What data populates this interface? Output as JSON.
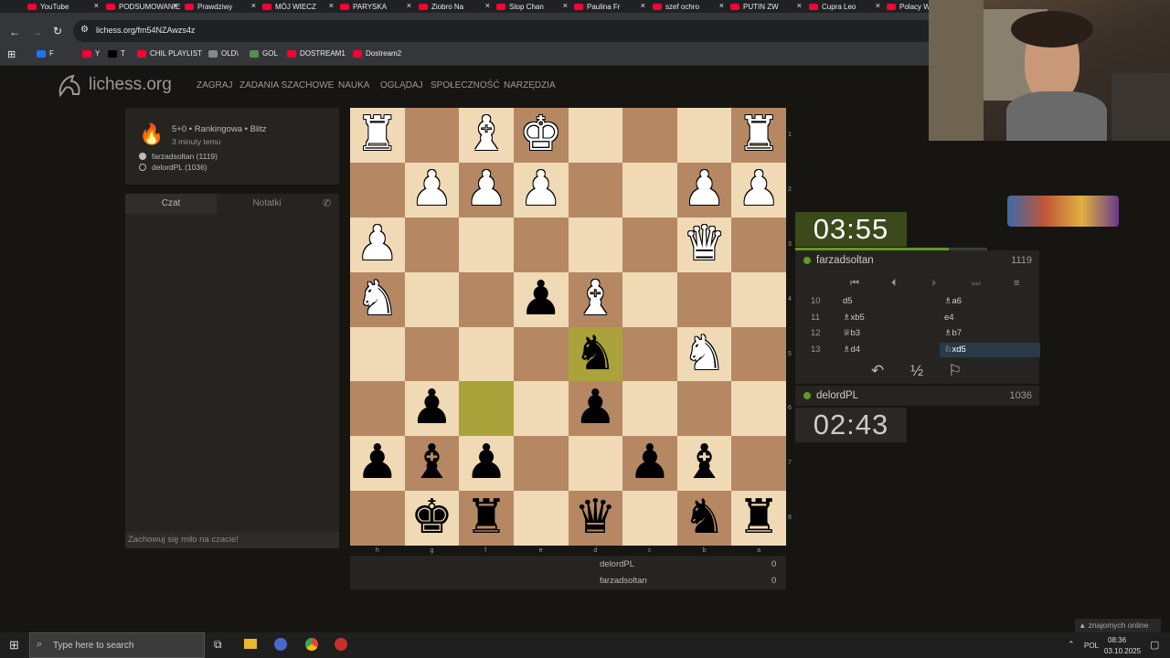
{
  "browser": {
    "tabs": [
      "YouTube",
      "PODSUMOWANIE",
      "Prawdziwy",
      "MÓJ WIECZ",
      "PARYSKA",
      "Ziobro Na",
      "Stop Chan",
      "Paulina Fr",
      "szef ochro",
      "PUTIN ZW",
      "Cupra Leo",
      "Polacy W"
    ],
    "url": "lichess.org/fm54NZAwzs4z",
    "bookmarks": [
      "F",
      "Y",
      "T",
      "CHIL PLAYLIST",
      "OLD\\",
      "GOL",
      "DOSTREAM1",
      "Dostream2"
    ]
  },
  "site": {
    "logo": "lichess.org",
    "nav": [
      "ZAGRAJ",
      "ZADANIA SZACHOWE",
      "NAUKA",
      "OGLĄDAJ",
      "SPOŁECZNOŚĆ",
      "NARZĘDZIA"
    ]
  },
  "game_meta": {
    "title": "5+0 • Rankingowa • Blitz",
    "time_ago": "3 minuty temu",
    "white": "farzadsoltan (1119)",
    "black": "delordPL (1036)"
  },
  "chat": {
    "tab_chat": "Czat",
    "tab_notes": "Notatki",
    "input_placeholder": "Zachowuj się miło na czacie!"
  },
  "board": {
    "orientation": "black",
    "ranks": [
      "1",
      "2",
      "3",
      "4",
      "5",
      "6",
      "7",
      "8"
    ],
    "files": [
      "h",
      "g",
      "f",
      "e",
      "d",
      "c",
      "b",
      "a"
    ],
    "highlight_squares": [
      "f6",
      "d5"
    ],
    "pieces": [
      {
        "sq": "h1",
        "p": "wR"
      },
      {
        "sq": "f1",
        "p": "wB"
      },
      {
        "sq": "e1",
        "p": "wK"
      },
      {
        "sq": "a1",
        "p": "wR"
      },
      {
        "sq": "g2",
        "p": "wP"
      },
      {
        "sq": "f2",
        "p": "wP"
      },
      {
        "sq": "e2",
        "p": "wP"
      },
      {
        "sq": "b2",
        "p": "wP"
      },
      {
        "sq": "a2",
        "p": "wP"
      },
      {
        "sq": "h3",
        "p": "wP"
      },
      {
        "sq": "b3",
        "p": "wQ"
      },
      {
        "sq": "h4",
        "p": "wN"
      },
      {
        "sq": "e4",
        "p": "bP"
      },
      {
        "sq": "d4",
        "p": "wB"
      },
      {
        "sq": "d5",
        "p": "bN"
      },
      {
        "sq": "b5",
        "p": "wN"
      },
      {
        "sq": "g6",
        "p": "bP"
      },
      {
        "sq": "d6",
        "p": "bP"
      },
      {
        "sq": "h7",
        "p": "bP"
      },
      {
        "sq": "g7",
        "p": "bB"
      },
      {
        "sq": "f7",
        "p": "bP"
      },
      {
        "sq": "c7",
        "p": "bP"
      },
      {
        "sq": "b7",
        "p": "bB"
      },
      {
        "sq": "g8",
        "p": "bK"
      },
      {
        "sq": "f8",
        "p": "bR"
      },
      {
        "sq": "d8",
        "p": "bQ"
      },
      {
        "sq": "b8",
        "p": "bN"
      },
      {
        "sq": "a8",
        "p": "bR"
      }
    ]
  },
  "clocks": {
    "top": "03:55",
    "bottom": "02:43",
    "top_progress": 0.8
  },
  "players": {
    "top": {
      "name": "farzadsoltan",
      "rating": "1119"
    },
    "bottom": {
      "name": "delordPL",
      "rating": "1036"
    }
  },
  "moves": [
    {
      "n": "10",
      "w": "d5",
      "b": "♗a6"
    },
    {
      "n": "11",
      "w": "♗xb5",
      "b": "e4"
    },
    {
      "n": "12",
      "w": "♕b3",
      "b": "♗b7"
    },
    {
      "n": "13",
      "w": "♗d4",
      "b": "♘xd5"
    }
  ],
  "scores": [
    {
      "name": "delordPL",
      "score": "0"
    },
    {
      "name": "farzadsoltan",
      "score": "0"
    }
  ],
  "taskbar": {
    "search_placeholder": "Type here to search",
    "lang": "POL",
    "time": "08:36",
    "date": "03.10.2025"
  },
  "friends": "znajomych online"
}
